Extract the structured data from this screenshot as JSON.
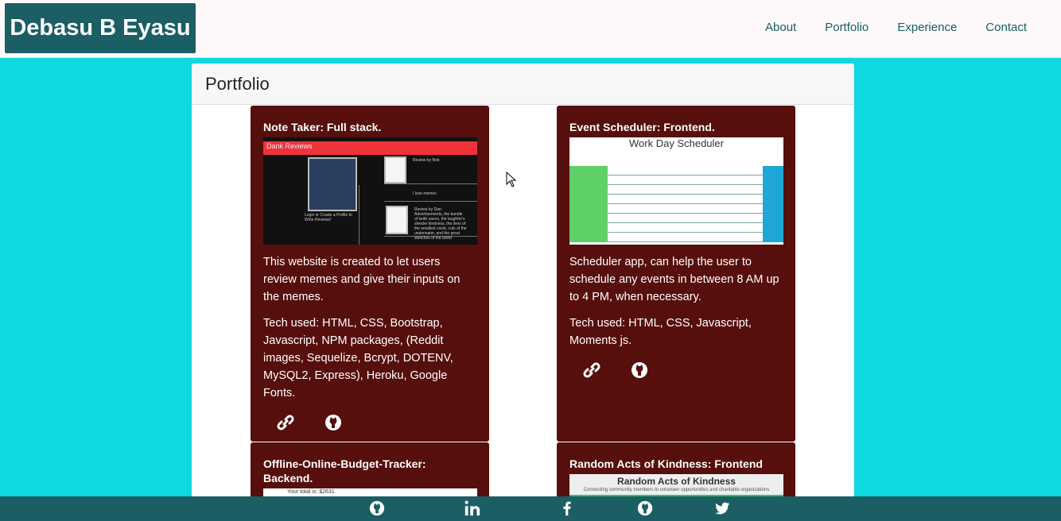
{
  "header": {
    "brand": "Debasu B Eyasu",
    "nav": [
      "About",
      "Portfolio",
      "Experience",
      "Contact"
    ]
  },
  "portfolio": {
    "title": "Portfolio",
    "cards": [
      {
        "title": "Note Taker: Full stack.",
        "screenshot_text": "Dank Reviews",
        "description": "This website is created to let users review memes and give their inputs on the memes.",
        "tech": "Tech used: HTML, CSS, Bootstrap, Javascript, NPM packages, (Reddit images, Sequelize, Bcrypt, DOTENV, MySQL2, Express), Heroku, Google Fonts."
      },
      {
        "title": "Event Scheduler: Frontend.",
        "screenshot_text": "Work Day Scheduler",
        "description": "Scheduler app, can help the user to schedule any events in between 8 AM up to 4 PM, when necessary.",
        "tech": "Tech used: HTML, CSS, Javascript, Moments js."
      },
      {
        "title": "Offline-Online-Budget-Tracker: Backend.",
        "screenshot_text": "Your total is: $2631"
      },
      {
        "title": "Random Acts of Kindness: Frontend",
        "screenshot_text": "Random Acts of Kindness",
        "screenshot_subtext": "Connecting community members to volunteer opportunities and charitable organizations"
      }
    ]
  },
  "icons": {
    "link": "link-icon",
    "github": "github-icon",
    "linkedin": "linkedin-icon",
    "facebook": "facebook-icon",
    "twitter": "twitter-icon"
  },
  "colors": {
    "background": "#0fd8e0",
    "brand": "#1b5e63",
    "card": "#560f0c",
    "footer": "#1b5e63"
  }
}
